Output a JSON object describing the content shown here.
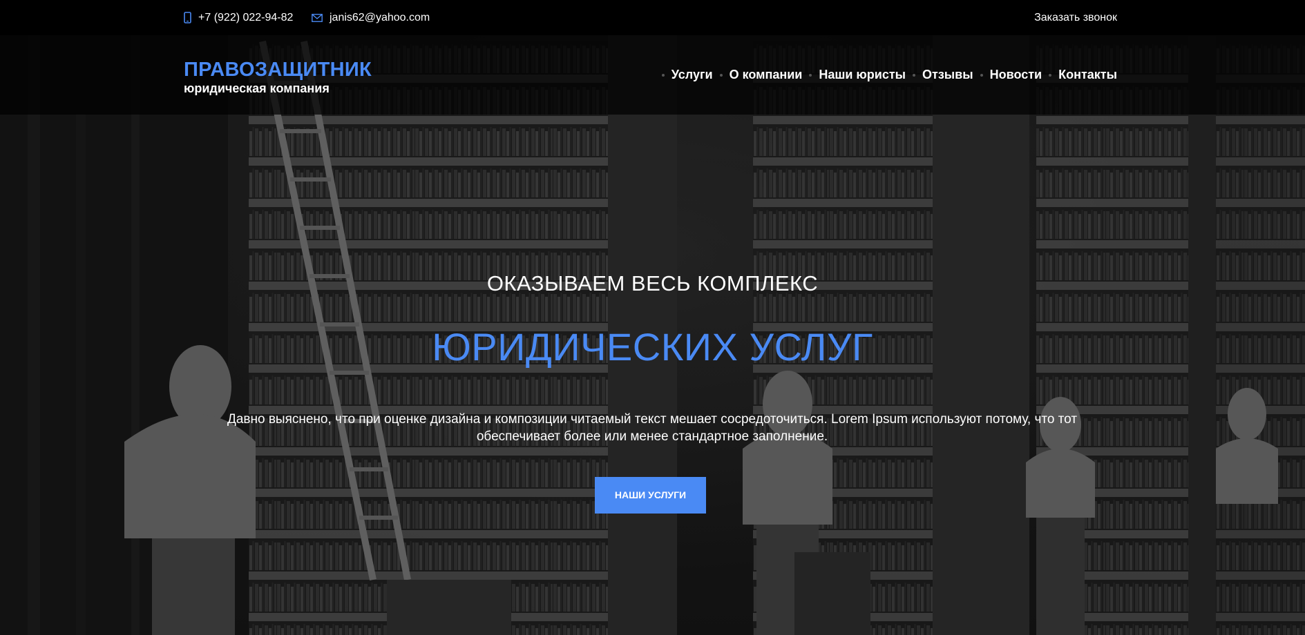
{
  "topbar": {
    "phone": "+7 (922) 022-94-82",
    "email": "janis62@yahoo.com",
    "callback_label": "Заказать звонок",
    "phone_icon": "phone-icon",
    "email_icon": "envelope-icon"
  },
  "header": {
    "logo_title": "ПРАВОЗАЩИТНИК",
    "logo_subtitle": "юридическая компания",
    "nav": [
      {
        "label": "Услуги"
      },
      {
        "label": "О компании"
      },
      {
        "label": "Наши юристы"
      },
      {
        "label": "Отзывы"
      },
      {
        "label": "Новости"
      },
      {
        "label": "Контакты"
      }
    ]
  },
  "hero": {
    "pretitle": "ОКАЗЫВАЕМ ВЕСЬ КОМПЛЕКС",
    "title": "ЮРИДИЧЕСКИХ УСЛУГ",
    "text": "Давно выяснено, что при оценке дизайна и композиции читаемый текст мешает сосредоточиться. Lorem Ipsum используют потому, что тот обеспечивает более или менее стандартное заполнение.",
    "button_label": "НАШИ УСЛУГИ"
  },
  "colors": {
    "accent": "#4a8af4",
    "topbar_bg": "#000000",
    "text": "#ffffff"
  }
}
